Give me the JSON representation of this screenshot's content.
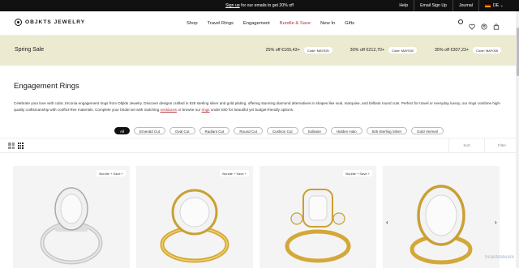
{
  "topbar": {
    "promo_link": "Sign up",
    "promo_rest": " for our emails to get 20% off",
    "help": "Help",
    "email_signup": "Email Sign Up",
    "journal": "Journal",
    "country": "DE"
  },
  "header": {
    "logo": "OBJKTS JEWELRY",
    "nav": [
      "Shop",
      "Travel Rings",
      "Engagement",
      "Bundle & Save",
      "New In",
      "Gifts"
    ]
  },
  "banner": {
    "title": "Spring Sale",
    "offers": [
      {
        "text": "25% off €165,43+",
        "code": "Code: MAY025"
      },
      {
        "text": "30% off €212,70+",
        "code": "Code: MAY030"
      },
      {
        "text": "35% off €307,23+",
        "code": "Code: MAY035"
      }
    ]
  },
  "page": {
    "title": "Engagement Rings",
    "desc_1": "Celebrate your love with cubic zirconia engagement rings from Objkts Jewelry. Discover designs crafted in 925 sterling silver and gold plating, offering stunning diamond alternatives in shapes like oval, marquise, and brilliant round cuts. Perfect for travel or everyday luxury, our rings combine high-quality craftsmanship with conflict-free materials. Complete your bridal set with matching ",
    "desc_link1": "necklaces",
    "desc_2": " or browse our ",
    "desc_link2": "rings",
    "desc_3": " under £80 for beautiful yet budget-friendly options."
  },
  "chips": [
    "All",
    "Emerald Cut",
    "Oval Cut",
    "Radiant Cut",
    "Round Cut",
    "Cushion Cut",
    "Solitaire",
    "Hidden Halo",
    "925 Sterling Silver",
    "Gold Vermeil"
  ],
  "toolbar": {
    "sort": "Sort",
    "filter": "Filter"
  },
  "products": [
    {
      "badge": "Bundle + Save +",
      "metal": "silver"
    },
    {
      "badge": "Bundle + Save +",
      "metal": "gold"
    },
    {
      "badge": "Bundle + Save +",
      "metal": "gold"
    },
    {
      "badge": "",
      "metal": "gold"
    }
  ],
  "carousel": {
    "prev": "‹",
    "next": "›"
  },
  "watermark": "ScanMalware",
  "colors": {
    "accent": "#b0333b",
    "banner_bg": "#ecebd2",
    "topbar_bg": "#111111"
  }
}
